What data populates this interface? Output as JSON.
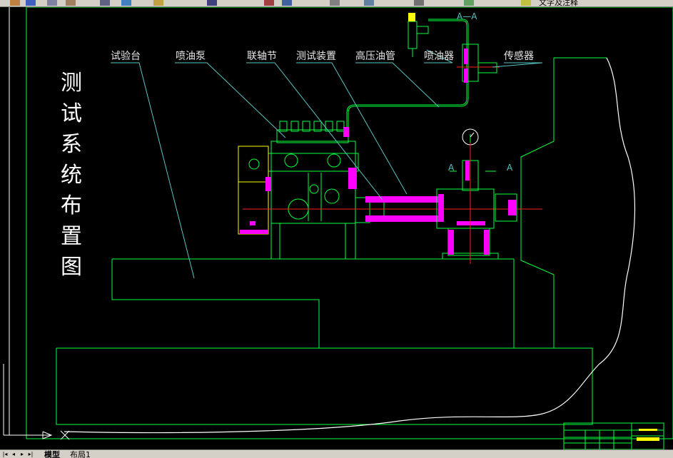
{
  "toolbar": {
    "text_style_label": "文字及注释",
    "icons": [
      "undo-icon",
      "save-icon",
      "print-icon",
      "paste-icon",
      "zoom-icon",
      "pan-icon",
      "layer-icon",
      "text-style-icon"
    ]
  },
  "drawing": {
    "title_chars": [
      "测",
      "试",
      "系",
      "统",
      "布",
      "置",
      "图"
    ],
    "callouts": {
      "test_bench": "试验台",
      "injection_pump": "喷油泵",
      "coupling": "联轴节",
      "test_device": "测试装置",
      "hp_oil_pipe": "高压油管",
      "injector": "喷油器",
      "sensor": "传感器"
    },
    "section_title": "A—A",
    "section_mark_left": "A",
    "section_mark_right": "A"
  },
  "layout_tabs": {
    "model": "模型",
    "layout1": "布局1"
  },
  "colors": {
    "background": "#000000",
    "green": "#00ff3c",
    "magenta": "#ff00ff",
    "cyan": "#59c4c4",
    "white": "#ffffff",
    "red": "#ff2020",
    "yellow": "#ffff00"
  }
}
